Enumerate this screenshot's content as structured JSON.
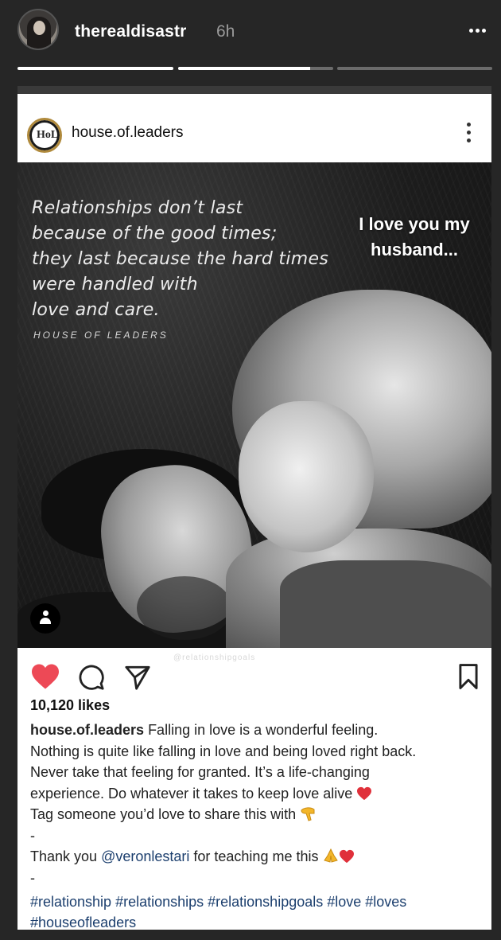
{
  "story": {
    "username": "therealdisastr",
    "time": "6h",
    "progress": [
      1.0,
      0.85,
      0.0
    ],
    "overlay_text": "I love you my husband..."
  },
  "post": {
    "account": "house.of.leaders",
    "avatar_monogram": "HoL",
    "quote_lines": [
      "Relationships don’t last",
      "because of the good times;",
      "they last because the hard times",
      "were handled with",
      "love and care."
    ],
    "brand": "HOUSE OF LEADERS",
    "watermark": "@relationshipgoals",
    "likes": "10,120 likes",
    "liked": true,
    "caption": {
      "handle": "house.of.leaders",
      "line1": "Falling in love is a wonderful feeling.",
      "line2": "Nothing is quite like falling in love and being loved right back.",
      "line3": "Never take that feeling for granted. It’s a life-changing",
      "line4": "experience. Do whatever it takes to keep love alive",
      "line5": "Tag someone you’d love to share this with",
      "dash1": "-",
      "thanks_pre": "Thank you ",
      "mention": "@veronlestari",
      "thanks_post": " for teaching me this",
      "dash2": "-"
    },
    "hashtags": [
      "#relationship #relationships #relationshipgoals #love #loves",
      "#houseofleaders"
    ]
  },
  "colors": {
    "background": "#262626",
    "heart": "#ed4956",
    "link": "#1c3f6e"
  },
  "icons": [
    "more-icon",
    "heart-icon",
    "comment-icon",
    "share-icon",
    "bookmark-icon",
    "user-tag-icon"
  ]
}
